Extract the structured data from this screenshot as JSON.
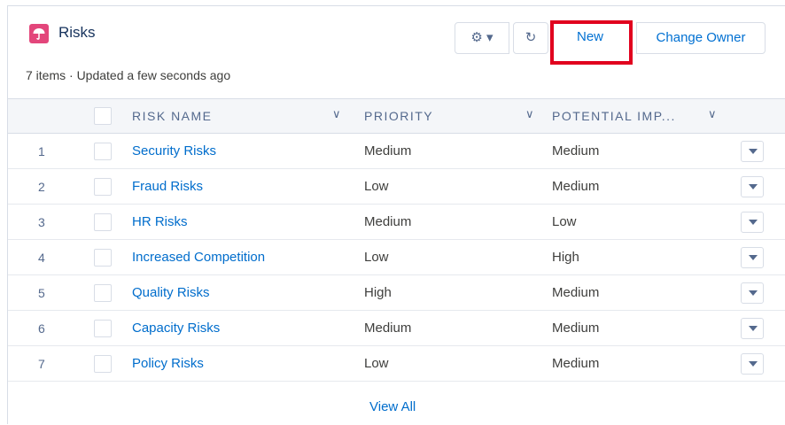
{
  "header": {
    "title": "Risks",
    "meta": "7 items · Updated a few seconds ago",
    "icon": "umbrella-icon",
    "icon_color": "#e3467b"
  },
  "toolbar": {
    "gear_label": "⚙ ▾",
    "refresh_label": "↻",
    "new_label": "New",
    "change_owner_label": "Change Owner"
  },
  "table": {
    "columns": [
      "RISK NAME",
      "PRIORITY",
      "POTENTIAL IMP..."
    ],
    "rows": [
      {
        "num": "1",
        "name": "Security Risks",
        "priority": "Medium",
        "impact": "Medium"
      },
      {
        "num": "2",
        "name": "Fraud Risks",
        "priority": "Low",
        "impact": "Medium"
      },
      {
        "num": "3",
        "name": "HR Risks",
        "priority": "Medium",
        "impact": "Low"
      },
      {
        "num": "4",
        "name": "Increased Competition",
        "priority": "Low",
        "impact": "High"
      },
      {
        "num": "5",
        "name": "Quality Risks",
        "priority": "High",
        "impact": "Medium"
      },
      {
        "num": "6",
        "name": "Capacity Risks",
        "priority": "Medium",
        "impact": "Medium"
      },
      {
        "num": "7",
        "name": "Policy Risks",
        "priority": "Low",
        "impact": "Medium"
      }
    ]
  },
  "footer": {
    "view_all": "View All"
  },
  "colors": {
    "highlight": "#e1001e",
    "link": "#006dcc"
  }
}
